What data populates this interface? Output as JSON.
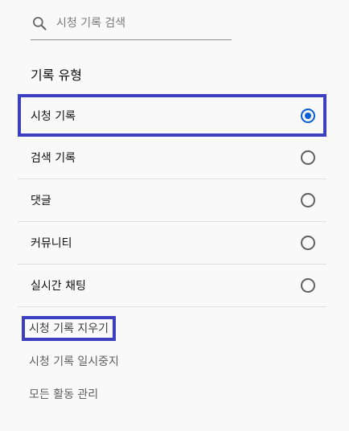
{
  "search": {
    "placeholder": "시청 기록 검색",
    "icon": "search-icon"
  },
  "section_title": "기록 유형",
  "history_types": [
    {
      "label": "시청 기록",
      "selected": true
    },
    {
      "label": "검색 기록",
      "selected": false
    },
    {
      "label": "댓글",
      "selected": false
    },
    {
      "label": "커뮤니티",
      "selected": false
    },
    {
      "label": "실시간 채팅",
      "selected": false
    }
  ],
  "actions": {
    "clear": "시청 기록 지우기",
    "pause": "시청 기록 일시중지",
    "manage": "모든 활동 관리"
  },
  "colors": {
    "highlight_border": "#3c3fbf",
    "radio_selected": "#065fd4",
    "radio_unselected": "#606060",
    "background": "#f9f9f9"
  }
}
